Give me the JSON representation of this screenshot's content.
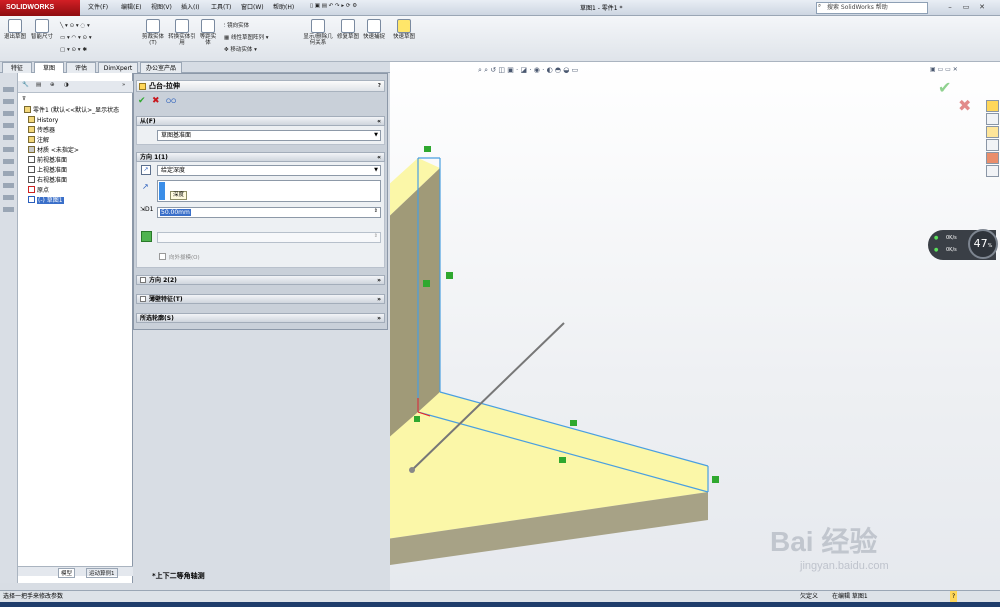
{
  "app": {
    "logo": "SOLIDWORKS",
    "title": "草图1 - 零件1 *"
  },
  "menu": [
    "文件(F)",
    "编辑(E)",
    "视图(V)",
    "插入(I)",
    "工具(T)",
    "窗口(W)",
    "帮助(H)"
  ],
  "search": {
    "placeholder": "搜索 SolidWorks 帮助"
  },
  "ribbon": {
    "big_buttons": [
      "退出草图",
      "智能尺寸",
      "剪裁实体(T)",
      "转换实体引用",
      "等距实体",
      "显示/删除几何关系",
      "修复草图",
      "快速捕捉",
      "快速草图"
    ],
    "small_buttons": [
      "镜向实体",
      "线性草图阵列",
      "移动实体"
    ]
  },
  "cm_tabs": [
    "特征",
    "草图",
    "评估",
    "DimXpert",
    "办公室产品"
  ],
  "tree": {
    "root": "零件1 (默认<<默认>_显示状态",
    "items": [
      "History",
      "传感器",
      "注解",
      "材质 <未指定>",
      "前视基准面",
      "上视基准面",
      "右视基准面",
      "原点",
      "(-) 草图1"
    ]
  },
  "property_manager": {
    "title": "凸台-拉伸",
    "from_label": "从(F)",
    "from_value": "草图基准面",
    "dir1_label": "方向 1(1)",
    "end_condition": "给定深度",
    "depth_tooltip": "深度",
    "depth_value": "50.00mm",
    "draft_outward": "向外拔模(O)",
    "dir2_label": "方向 2(2)",
    "thin_feature": "薄壁特征(T)",
    "selected_contours": "所选轮廓(S)"
  },
  "viewport": {
    "orientation": "*上下二等角轴测",
    "zoom_percent": "47"
  },
  "speed": {
    "up": "0K/s",
    "down": "0K/s",
    "pct_sign": "%"
  },
  "bottom_tabs": [
    "模型",
    "运动算例1"
  ],
  "status": {
    "left": "选择一把手来修改参数",
    "undefined": "欠定义",
    "editing": "在编辑 草图1",
    "help": "?"
  },
  "watermark": {
    "brand": "Bai 经验",
    "url": "jingyan.baidu.com"
  },
  "colors": {
    "accent_red": "#c8161d",
    "face_yellow": "#fbf7a8",
    "sketch_blue": "#4a9fe0",
    "ok_green": "#2fa82f"
  }
}
